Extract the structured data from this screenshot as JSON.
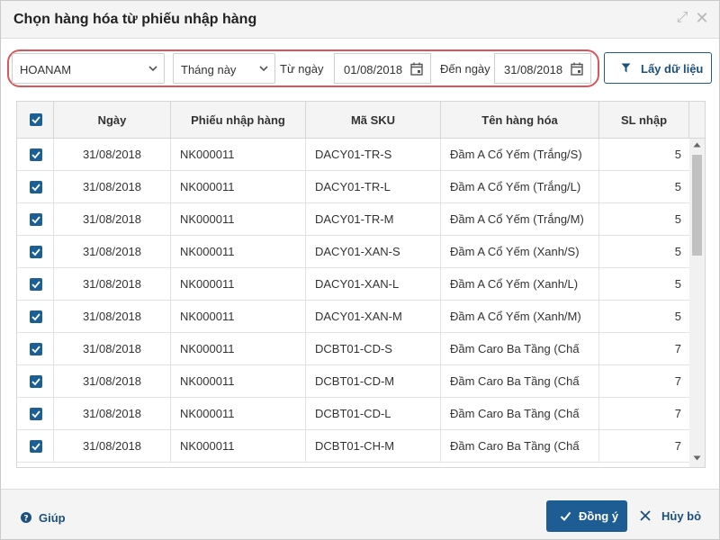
{
  "dialog": {
    "title": "Chọn hàng hóa từ phiếu nhập hàng"
  },
  "filters": {
    "branch": "HOANAM",
    "period": "Tháng này",
    "from_label": "Từ ngày",
    "from_date": "01/08/2018",
    "to_label": "Đến ngày",
    "to_date": "31/08/2018",
    "fetch_label": "Lấy dữ liệu"
  },
  "table": {
    "columns": [
      "Ngày",
      "Phiếu nhập hàng",
      "Mã SKU",
      "Tên hàng hóa",
      "SL nhập"
    ],
    "rows": [
      {
        "date": "31/08/2018",
        "receipt": "NK000011",
        "sku": "DACY01-TR-S",
        "name": "Đầm A Cổ Yếm (Trắng/S)",
        "qty": "5"
      },
      {
        "date": "31/08/2018",
        "receipt": "NK000011",
        "sku": "DACY01-TR-L",
        "name": "Đầm A Cổ Yếm (Trắng/L)",
        "qty": "5"
      },
      {
        "date": "31/08/2018",
        "receipt": "NK000011",
        "sku": "DACY01-TR-M",
        "name": "Đầm A Cổ Yếm (Trắng/M)",
        "qty": "5"
      },
      {
        "date": "31/08/2018",
        "receipt": "NK000011",
        "sku": "DACY01-XAN-S",
        "name": "Đầm A Cổ Yếm (Xanh/S)",
        "qty": "5"
      },
      {
        "date": "31/08/2018",
        "receipt": "NK000011",
        "sku": "DACY01-XAN-L",
        "name": "Đầm A Cổ Yếm (Xanh/L)",
        "qty": "5"
      },
      {
        "date": "31/08/2018",
        "receipt": "NK000011",
        "sku": "DACY01-XAN-M",
        "name": "Đầm A Cổ Yếm (Xanh/M)",
        "qty": "5"
      },
      {
        "date": "31/08/2018",
        "receipt": "NK000011",
        "sku": "DCBT01-CD-S",
        "name": "Đầm Caro Ba Tầng (Chấ",
        "qty": "7"
      },
      {
        "date": "31/08/2018",
        "receipt": "NK000011",
        "sku": "DCBT01-CD-M",
        "name": "Đầm Caro Ba Tầng (Chấ",
        "qty": "7"
      },
      {
        "date": "31/08/2018",
        "receipt": "NK000011",
        "sku": "DCBT01-CD-L",
        "name": "Đầm Caro Ba Tầng (Chấ",
        "qty": "7"
      },
      {
        "date": "31/08/2018",
        "receipt": "NK000011",
        "sku": "DCBT01-CH-M",
        "name": "Đầm Caro Ba Tầng (Chấ",
        "qty": "7"
      }
    ]
  },
  "footer": {
    "help_label": "Giúp",
    "ok_label": "Đồng ý",
    "cancel_label": "Hủy bỏ"
  },
  "colors": {
    "primary": "#1e5d93",
    "highlight_oval": "#d9575b"
  }
}
